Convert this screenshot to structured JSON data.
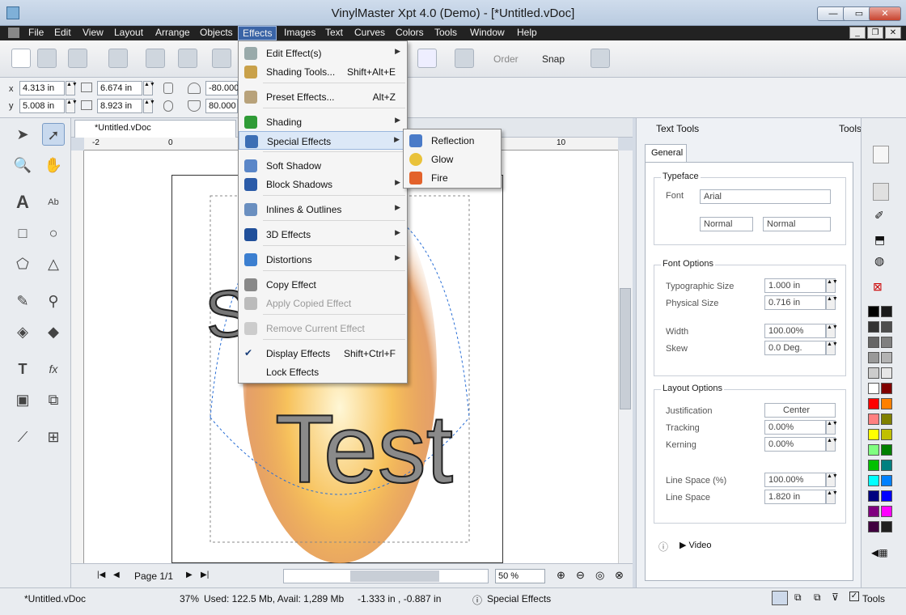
{
  "window": {
    "title": "VinylMaster Xpt 4.0 (Demo) - [*Untitled.vDoc]"
  },
  "menubar": {
    "items": [
      "File",
      "Edit",
      "View",
      "Layout",
      "Arrange",
      "Objects",
      "Effects",
      "Images",
      "Text",
      "Curves",
      "Colors",
      "Tools",
      "Window",
      "Help"
    ],
    "active": "Effects"
  },
  "toolbar": {
    "order_label": "Order",
    "snap_label": "Snap"
  },
  "propbar": {
    "x_label": "x",
    "y_label": "y",
    "x_value": "4.313 in",
    "y_value": "5.008 in",
    "w_value": "6.674 in",
    "h_value": "8.923 in",
    "angle1": "-80.000",
    "angle2": "80.000"
  },
  "document": {
    "tab_label": "*Untitled.vDoc",
    "ruler_ticks": [
      "-2",
      "0",
      "10"
    ],
    "text_top": "Sofdia",
    "text_bottom": "Test"
  },
  "effects_menu": [
    {
      "label": "Edit Effect(s)",
      "shortcut": "",
      "submenu": true,
      "disabled": false
    },
    {
      "label": "Shading Tools...",
      "shortcut": "Shift+Alt+E",
      "submenu": false,
      "disabled": false
    },
    {
      "label": "Preset Effects...",
      "shortcut": "Alt+Z",
      "submenu": false,
      "disabled": false
    },
    {
      "label": "Shading",
      "shortcut": "",
      "submenu": true,
      "disabled": false
    },
    {
      "label": "Special Effects",
      "shortcut": "",
      "submenu": true,
      "disabled": false,
      "highlighted": true
    },
    {
      "label": "Soft Shadow",
      "shortcut": "",
      "submenu": false,
      "disabled": false
    },
    {
      "label": "Block Shadows",
      "shortcut": "",
      "submenu": true,
      "disabled": false
    },
    {
      "label": "Inlines & Outlines",
      "shortcut": "",
      "submenu": true,
      "disabled": false
    },
    {
      "label": "3D Effects",
      "shortcut": "",
      "submenu": true,
      "disabled": false
    },
    {
      "label": "Distortions",
      "shortcut": "",
      "submenu": true,
      "disabled": false
    },
    {
      "label": "Copy Effect",
      "shortcut": "",
      "submenu": false,
      "disabled": false
    },
    {
      "label": "Apply Copied Effect",
      "shortcut": "",
      "submenu": false,
      "disabled": true
    },
    {
      "label": "Remove Current Effect",
      "shortcut": "",
      "submenu": false,
      "disabled": true
    },
    {
      "label": "Display Effects",
      "shortcut": "Shift+Ctrl+F",
      "submenu": false,
      "disabled": false,
      "checked": true
    },
    {
      "label": "Lock Effects",
      "shortcut": "",
      "submenu": false,
      "disabled": false
    }
  ],
  "special_effects_submenu": [
    "Reflection",
    "Glow",
    "Fire"
  ],
  "navbar": {
    "page_label": "Page 1/1",
    "zoom": "50 %"
  },
  "right_panel": {
    "header": "Text Tools",
    "tools_label": "Tools",
    "tab": "General",
    "typeface": {
      "title": "Typeface",
      "font_label": "Font",
      "font_value": "Arial",
      "style_value": "Normal",
      "style2_value": "Normal"
    },
    "font_options": {
      "title": "Font Options",
      "rows": [
        {
          "label": "Typographic Size",
          "value": "1.000 in"
        },
        {
          "label": "Physical Size",
          "value": "0.716 in"
        },
        {
          "label": "Width",
          "value": "100.00%"
        },
        {
          "label": "Skew",
          "value": "0.0 Deg."
        }
      ]
    },
    "layout_options": {
      "title": "Layout Options",
      "rows": [
        {
          "label": "Justification",
          "value": "Center"
        },
        {
          "label": "Tracking",
          "value": "0.00%"
        },
        {
          "label": "Kerning",
          "value": "0.00%"
        },
        {
          "label": "Line Space (%)",
          "value": "100.00%"
        },
        {
          "label": "Line Space",
          "value": "1.820 in"
        }
      ]
    },
    "video_label": "Video"
  },
  "palette": [
    "#000000",
    "#1a1a1a",
    "#333333",
    "#4d4d4d",
    "#666666",
    "#808080",
    "#999999",
    "#b3b3b3",
    "#cccccc",
    "#e6e6e6",
    "#ffffff",
    "#800000",
    "#ff0000",
    "#ff8000",
    "#ff8080",
    "#808000",
    "#ffff00",
    "#c0c000",
    "#80ff80",
    "#008000",
    "#00c000",
    "#008080",
    "#00ffff",
    "#0080ff",
    "#000080",
    "#0000ff",
    "#800080",
    "#ff00ff",
    "#400040",
    "#202020"
  ],
  "statusbar": {
    "doc": "*Untitled.vDoc",
    "zoom": "37%",
    "memory": "Used: 122.5 Mb, Avail: 1,289 Mb",
    "coords": "-1.333 in , -0.887 in",
    "mode": "Special Effects",
    "tools": "Tools"
  }
}
